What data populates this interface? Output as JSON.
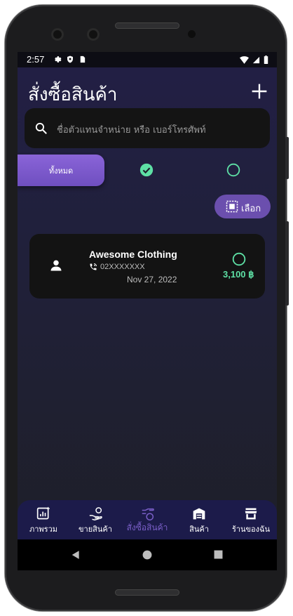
{
  "status_bar": {
    "time": "2:57"
  },
  "header": {
    "title": "สั่งซื้อสินค้า"
  },
  "search": {
    "placeholder": "ชื่อตัวแทนจำหน่าย หรือ เบอร์โทรศัพท์"
  },
  "filters": {
    "all_label": "ทั้งหมด"
  },
  "select_button": {
    "label": "เลือก"
  },
  "orders": [
    {
      "name": "Awesome Clothing",
      "phone": "02XXXXXXX",
      "date": "Nov 27, 2022",
      "amount": "3,100 ฿"
    }
  ],
  "bottom_nav": [
    {
      "label": "ภาพรวม",
      "icon": "dashboard-icon"
    },
    {
      "label": "ขายสินค้า",
      "icon": "sell-icon"
    },
    {
      "label": "สั่งซื้อสินค้า",
      "icon": "purchase-icon",
      "active": true
    },
    {
      "label": "สินค้า",
      "icon": "warehouse-icon"
    },
    {
      "label": "ร้านของฉัน",
      "icon": "store-icon"
    }
  ],
  "colors": {
    "accent": "#7a5fc8",
    "success": "#5ee0a5",
    "background": "#1f1e2c",
    "card": "#131313"
  }
}
